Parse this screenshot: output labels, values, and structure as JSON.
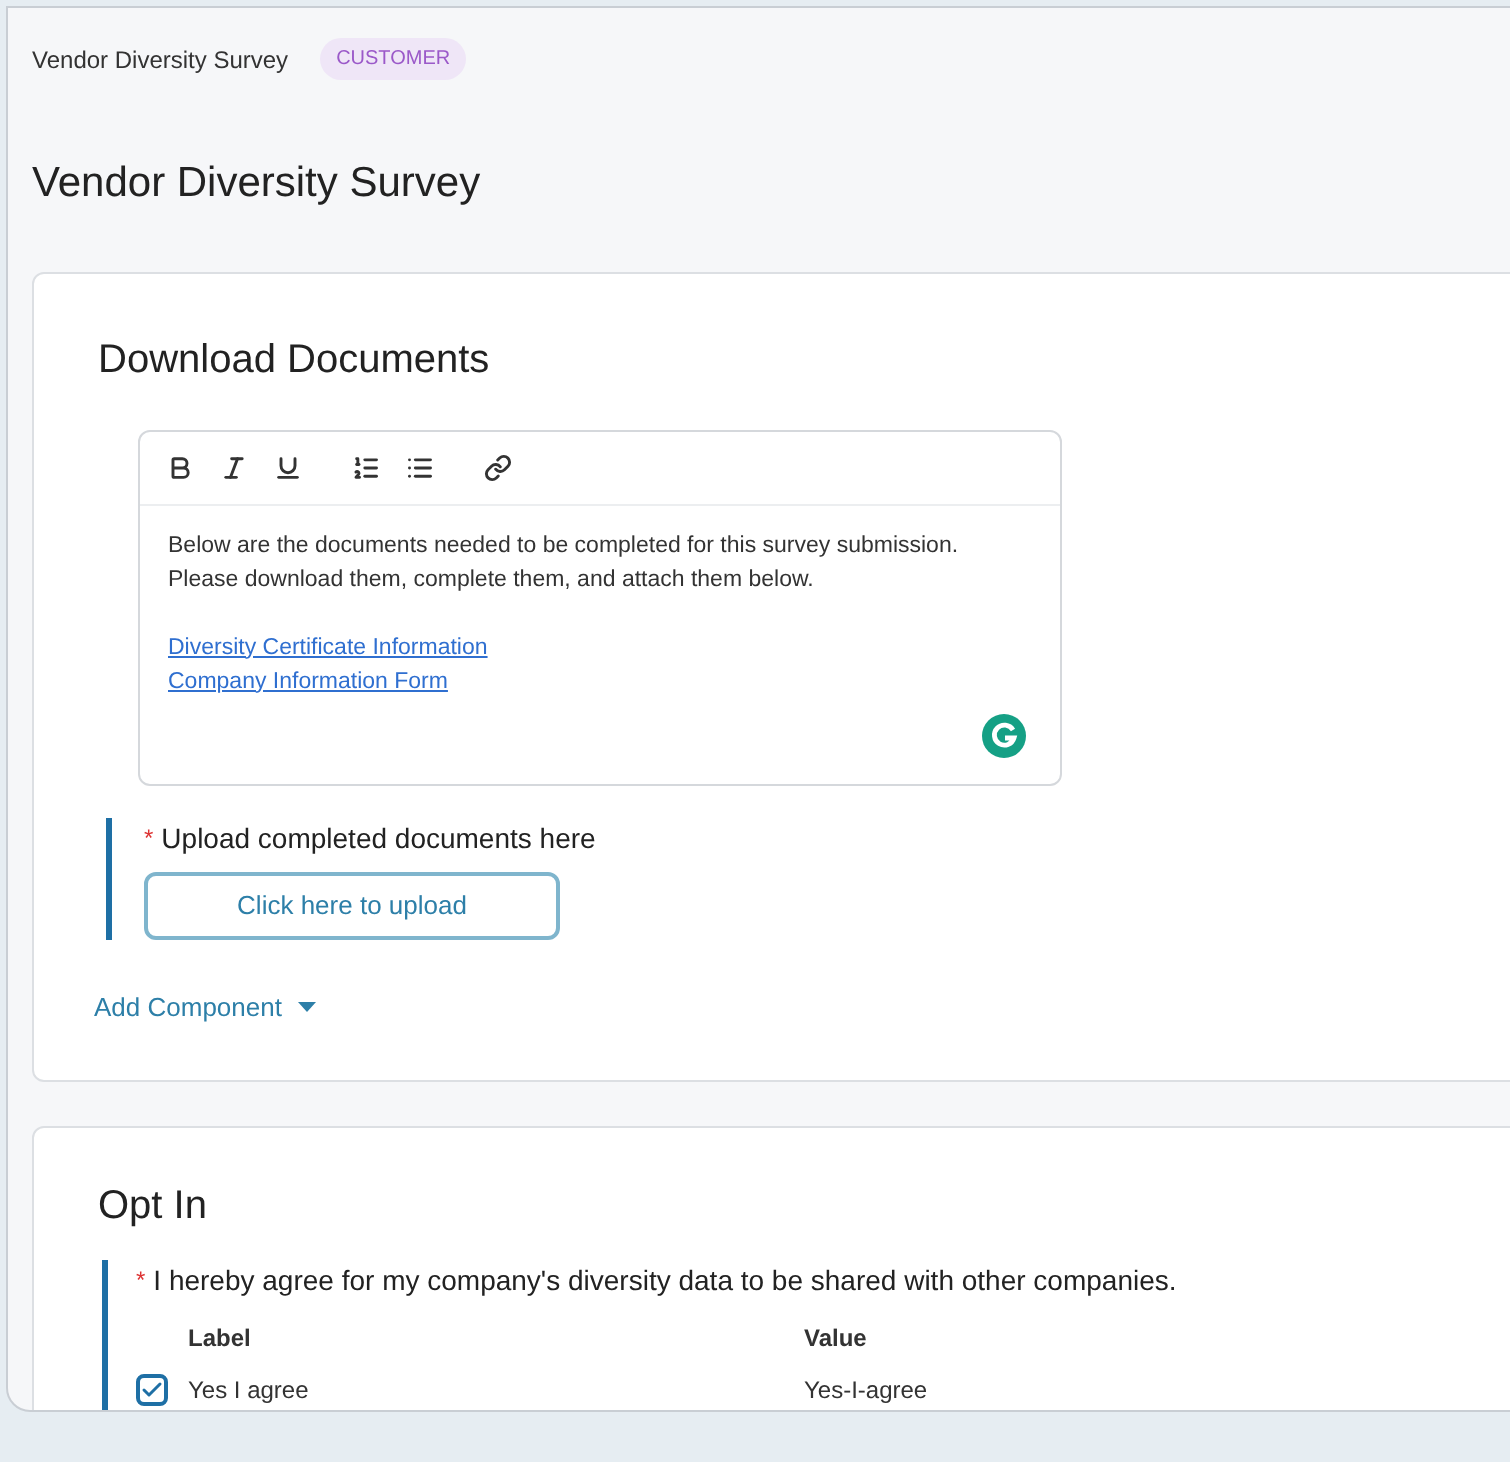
{
  "breadcrumb": {
    "title": "Vendor Diversity Survey",
    "badge": "CUSTOMER"
  },
  "page_title": "Vendor Diversity Survey",
  "download_section": {
    "title": "Download Documents",
    "editor": {
      "paragraphs": [
        "Below are the documents needed to be completed for this survey submission.",
        "Please download them, complete them, and attach them below."
      ],
      "links": [
        "Diversity Certificate Information",
        "Company Information Form"
      ]
    },
    "upload": {
      "mark": "*",
      "label": "Upload completed documents here",
      "button": "Click here to upload"
    },
    "add_component": "Add Component"
  },
  "opt_in_section": {
    "title": "Opt In",
    "question": {
      "mark": "*",
      "label": "I hereby agree for my company's diversity data to be shared with other companies."
    },
    "columns": [
      "Label",
      "Value"
    ],
    "options": [
      {
        "label": "Yes I agree",
        "value": "Yes-I-agree",
        "checked": true
      }
    ]
  }
}
